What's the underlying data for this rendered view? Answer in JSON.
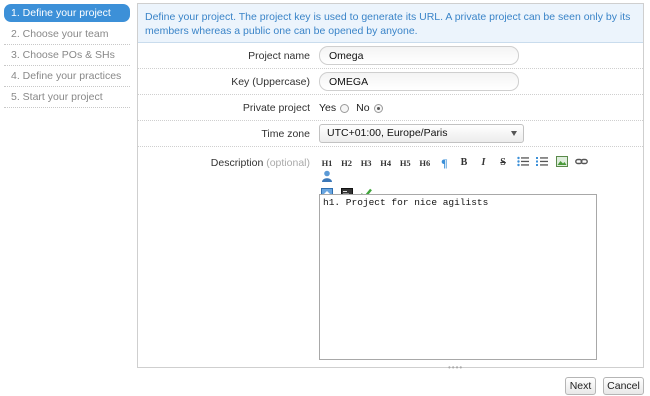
{
  "steps": [
    {
      "label": "1. Define your project",
      "active": true
    },
    {
      "label": "2. Choose your team",
      "active": false
    },
    {
      "label": "3. Choose POs & SHs",
      "active": false
    },
    {
      "label": "4. Define your practices",
      "active": false
    },
    {
      "label": "5. Start your project",
      "active": false
    }
  ],
  "info": {
    "text": "Define your project. The project key is used to generate its URL. A private project can be seen only by its members whereas a public one can be opened by anyone."
  },
  "form": {
    "project_name": {
      "label": "Project name",
      "value": "Omega"
    },
    "key": {
      "label": "Key (Uppercase)",
      "value": "OMEGA"
    },
    "private": {
      "label": "Private project",
      "yes_label": "Yes",
      "no_label": "No",
      "selected": "No"
    },
    "timezone": {
      "label": "Time zone",
      "value": "UTC+01:00, Europe/Paris"
    },
    "description": {
      "label": "Description",
      "optional": "(optional)",
      "value": "h1. Project for nice agilists"
    }
  },
  "toolbar": {
    "h1": "H1",
    "h2": "H2",
    "h3": "H3",
    "h4": "H4",
    "h5": "H5",
    "h6": "H6",
    "paragraph": "¶",
    "bold": "B",
    "italic": "I",
    "strike": "S"
  },
  "buttons": {
    "next": "Next",
    "cancel": "Cancel"
  },
  "colors": {
    "accent": "#3c90d8",
    "info_bg": "#ecf4fc",
    "info_text": "#3a84c8"
  }
}
